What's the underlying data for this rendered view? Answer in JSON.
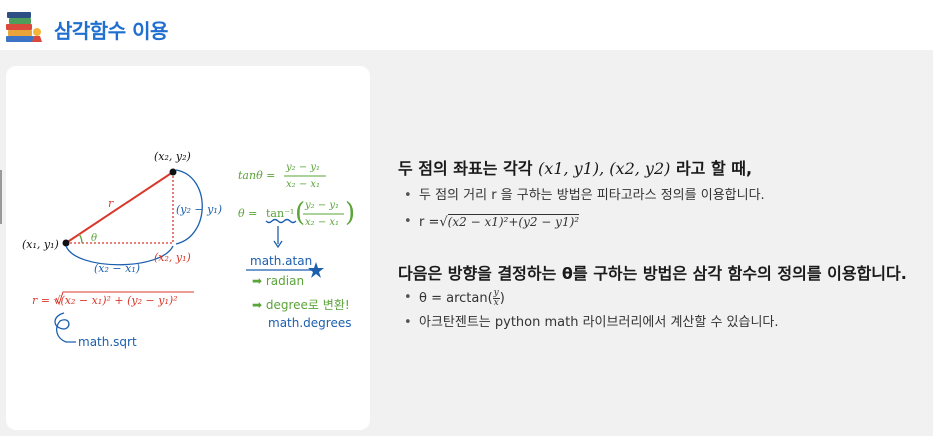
{
  "header": {
    "title": "삼각함수 이용"
  },
  "diagram": {
    "point1": "(x₁, y₁)",
    "point2": "(x₂, y₂)",
    "point3": "(x₂, y₁)",
    "side_r": "r",
    "angle": "θ",
    "dy": "(y₂ − y₁)",
    "dx": "(x₂ − x₁)",
    "tan_lhs": "tanθ =",
    "tan_num": "y₂ − y₁",
    "tan_den": "x₂ − x₁",
    "theta_lhs": "θ =",
    "theta_fn": "tan⁻¹",
    "atan_label": "math.atan",
    "radian_label": "➡ radian",
    "degree_label": "➡ degree로 변환!",
    "degrees_fn": "math.degrees",
    "r_formula": "r = √(x₂ − x₁)² + (y₂ − y₁)²",
    "sqrt_label": "math.sqrt"
  },
  "content": {
    "heading1_prefix": "두 점의 좌표는 각각 ",
    "heading1_math": "(x1, y1), (x2, y2)",
    "heading1_suffix": " 라고 할 때,",
    "bullets1": [
      "두 점의 거리 r 을 구하는 방법은 피타고라스 정의를 이용합니다.",
      "r ="
    ],
    "r_expr": "(x2 − x1)²+(y2 − y1)²",
    "heading2": "다음은 방향을 결정하는 θ를 구하는 방법은 삼각 함수의 정의를 이용합니다.",
    "theta_prefix": "θ = arctan(",
    "theta_num": "y",
    "theta_den": "x",
    "theta_suffix": ")",
    "bullet_last": "아크탄젠트는 python math 라이브러리에서 계산할 수 있습니다."
  },
  "colors": {
    "title": "#1f6fd1",
    "red": "#d9382b",
    "blue": "#1b5fad",
    "green": "#5aa43a"
  }
}
